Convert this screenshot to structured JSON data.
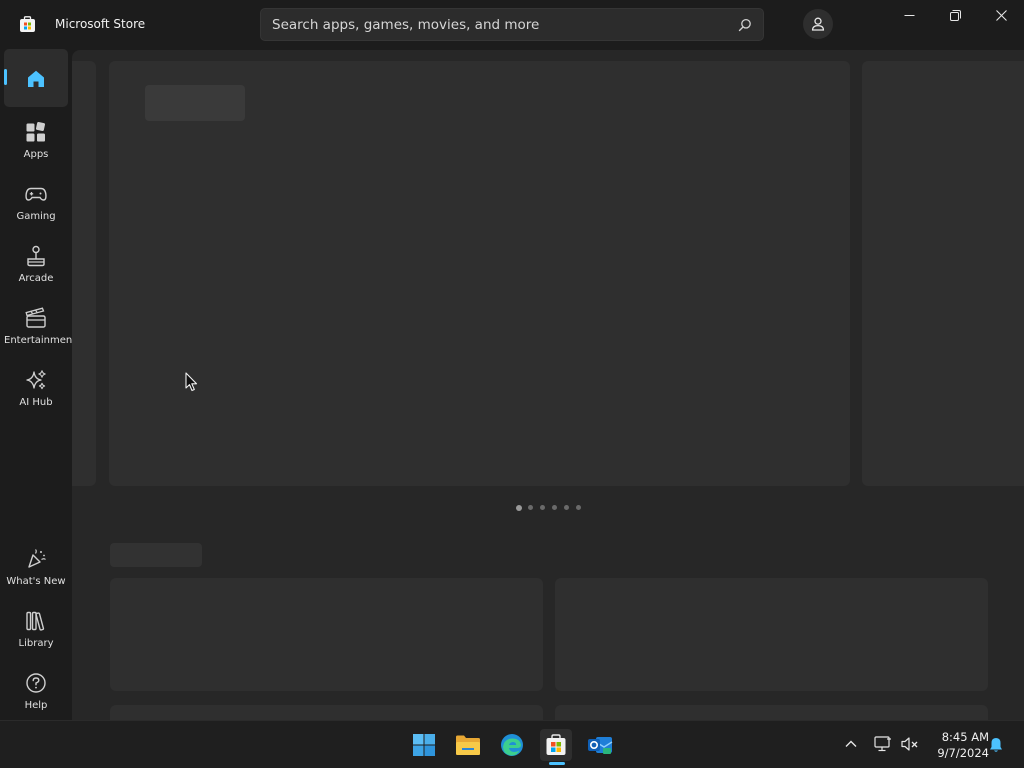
{
  "window": {
    "title": "Microsoft Store"
  },
  "search": {
    "placeholder": "Search apps, games, movies, and more"
  },
  "sidebar": {
    "items": [
      {
        "label": "",
        "icon": "home-icon",
        "active": true
      },
      {
        "label": "Apps",
        "icon": "apps-icon"
      },
      {
        "label": "Gaming",
        "icon": "gamepad-icon"
      },
      {
        "label": "Arcade",
        "icon": "joystick-icon"
      },
      {
        "label": "Entertainment",
        "icon": "clapperboard-icon"
      },
      {
        "label": "AI Hub",
        "icon": "sparkle-icon"
      }
    ],
    "bottom_items": [
      {
        "label": "What's New",
        "icon": "party-icon"
      },
      {
        "label": "Library",
        "icon": "library-icon"
      },
      {
        "label": "Help",
        "icon": "help-icon"
      }
    ]
  },
  "carousel": {
    "page_count": 6,
    "active_index": 0
  },
  "taskbar": {
    "apps": [
      "start-icon",
      "file-explorer-icon",
      "edge-icon",
      "store-icon",
      "outlook-icon"
    ],
    "active_app": "store-icon",
    "time": "8:45 AM",
    "date": "9/7/2024"
  },
  "colors": {
    "accent": "#4cc2ff",
    "background": "#1c1c1c",
    "content": "#272727",
    "placeholder": "#2f2f2f"
  }
}
